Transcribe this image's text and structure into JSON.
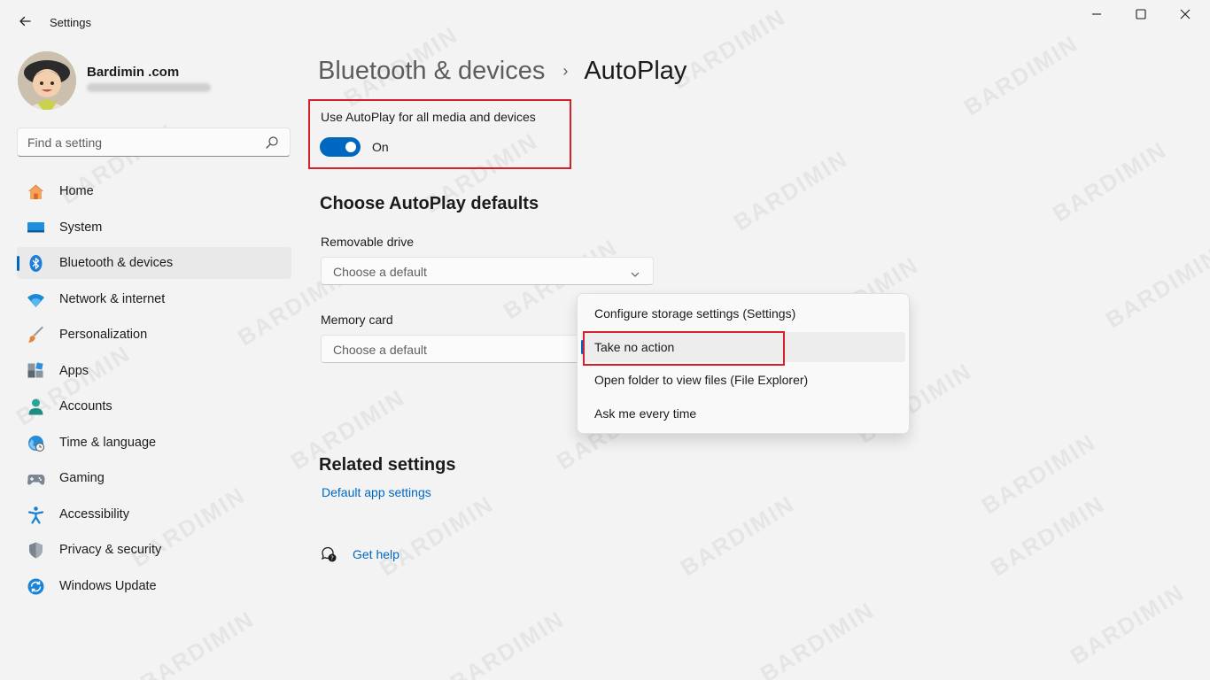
{
  "window": {
    "title": "Settings",
    "icons": {
      "back": "arrow-left-icon",
      "minimize": "minimize-icon",
      "maximize": "maximize-icon",
      "close": "close-icon"
    }
  },
  "profile": {
    "name": "Bardimin .com"
  },
  "search": {
    "placeholder": "Find a setting",
    "value": "",
    "icon": "search-icon"
  },
  "sidebar": {
    "accent_color": "#0067c0",
    "active_index": 2,
    "items": [
      {
        "label": "Home",
        "icon": "home-icon"
      },
      {
        "label": "System",
        "icon": "monitor-icon"
      },
      {
        "label": "Bluetooth & devices",
        "icon": "bluetooth-icon"
      },
      {
        "label": "Network & internet",
        "icon": "wifi-icon"
      },
      {
        "label": "Personalization",
        "icon": "brush-icon"
      },
      {
        "label": "Apps",
        "icon": "apps-icon"
      },
      {
        "label": "Accounts",
        "icon": "person-icon"
      },
      {
        "label": "Time & language",
        "icon": "globe-clock-icon"
      },
      {
        "label": "Gaming",
        "icon": "gamepad-icon"
      },
      {
        "label": "Accessibility",
        "icon": "accessibility-icon"
      },
      {
        "label": "Privacy & security",
        "icon": "shield-icon"
      },
      {
        "label": "Windows Update",
        "icon": "update-icon"
      }
    ]
  },
  "breadcrumb": {
    "parent": "Bluetooth & devices",
    "separator": "›",
    "current": "AutoPlay"
  },
  "autoplay": {
    "label": "Use AutoPlay for all media and devices",
    "toggle_on": true,
    "state_text": "On"
  },
  "defaults": {
    "title": "Choose AutoPlay defaults",
    "removable": {
      "label": "Removable drive",
      "value": "Choose a default"
    },
    "memory": {
      "label": "Memory card",
      "value": "Choose a default"
    }
  },
  "menu": {
    "selected_index": 1,
    "options": [
      "Configure storage settings (Settings)",
      "Take no action",
      "Open folder to view files (File Explorer)",
      "Ask me every time"
    ]
  },
  "related": {
    "title": "Related settings",
    "link": "Default app settings"
  },
  "help": {
    "label": "Get help",
    "icon": "help-chat-icon"
  },
  "watermark": {
    "text": "BARDIMIN"
  },
  "colors": {
    "highlight": "#d6202b",
    "link": "#0067c0"
  }
}
